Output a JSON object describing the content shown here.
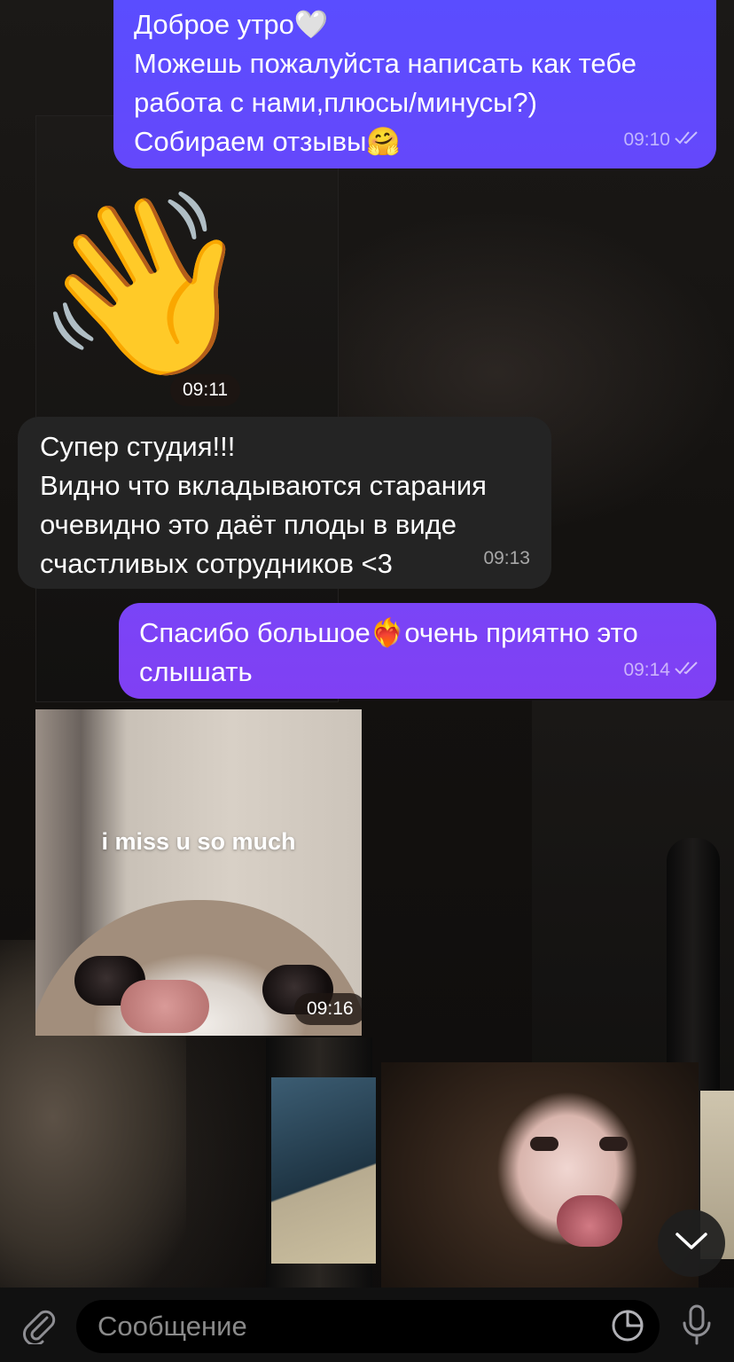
{
  "messages": [
    {
      "direction": "out",
      "lines": [
        "Доброе утро🤍",
        "Можешь пожалуйста написать как тебе",
        "работа с нами,плюсы/минусы?)",
        "Собираем отзывы🤗"
      ],
      "time": "09:10",
      "status": "read"
    },
    {
      "direction": "in",
      "type": "sticker",
      "emoji": "👋",
      "time": "09:11"
    },
    {
      "direction": "in",
      "lines": [
        "Супер студия!!!",
        "Видно что вкладываются старания",
        "очевидно это даёт плоды в виде",
        "счастливых сотрудников <3"
      ],
      "time": "09:13"
    },
    {
      "direction": "out",
      "lines": [
        "Спасибо большое❤️‍🔥очень приятно это",
        "слышать"
      ],
      "time": "09:14",
      "status": "read"
    },
    {
      "direction": "in",
      "type": "gif",
      "caption": "i miss u so much",
      "time": "09:16"
    },
    {
      "direction": "in",
      "type": "video",
      "icon": "video-thumbnail"
    }
  ],
  "composer": {
    "placeholder": "Сообщение",
    "attach_icon": "paperclip-icon",
    "sticker_icon": "sticker-icon",
    "mic_icon": "microphone-icon"
  },
  "scroll_icon": "chevron-down-icon",
  "colors": {
    "bubble_out_top": "#5b4cff",
    "bubble_out_bottom": "#7c43f5",
    "bubble_in": "#242424",
    "background": "#141210"
  }
}
